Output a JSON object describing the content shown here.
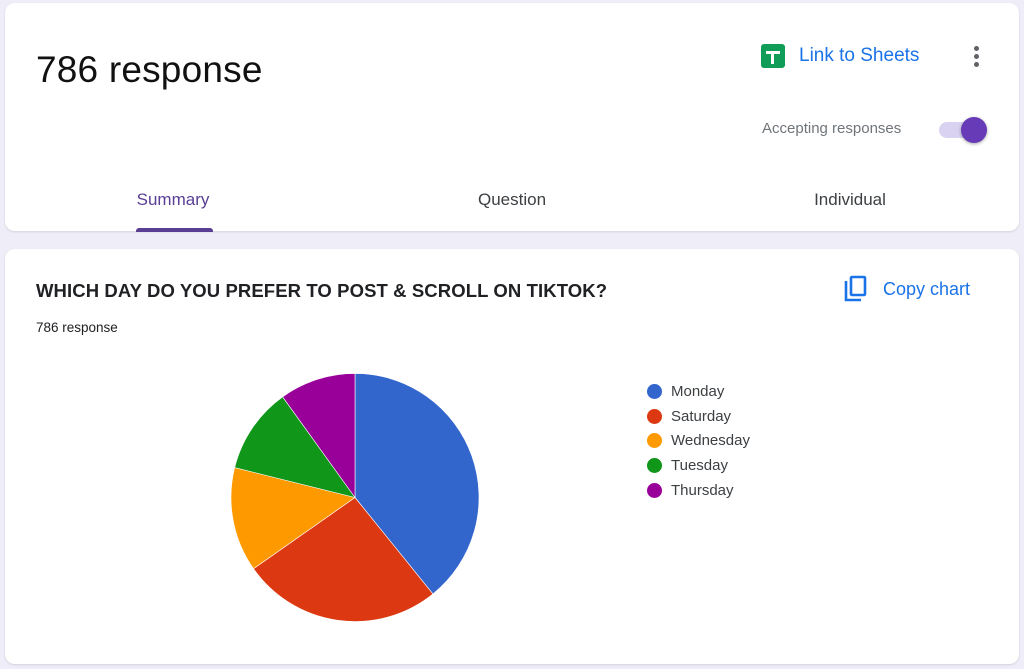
{
  "header": {
    "title": "786 response",
    "link_sheets_label": "Link to Sheets",
    "more_icon": "more-vert-icon",
    "accepting_label": "Accepting responses",
    "accepting_on": true
  },
  "tabs": [
    {
      "label": "Summary",
      "active": true
    },
    {
      "label": "Question",
      "active": false
    },
    {
      "label": "Individual",
      "active": false
    }
  ],
  "question": {
    "title": "WHICH DAY DO YOU PREFER TO POST & SCROLL ON TIKTOK?",
    "count": "786 response",
    "copy_chart_label": "Copy chart"
  },
  "chart_data": {
    "type": "pie",
    "title": "WHICH DAY DO YOU PREFER TO POST & SCROLL ON TIKTOK?",
    "total": 786,
    "categories": [
      "Monday",
      "Saturday",
      "Wednesday",
      "Tuesday",
      "Thursday"
    ],
    "values": [
      308,
      205,
      107,
      88,
      78
    ],
    "percentages": [
      39.1,
      26.1,
      13.6,
      11.2,
      9.9
    ],
    "colors": [
      "#3366cc",
      "#dc3912",
      "#ff9900",
      "#109618",
      "#990099"
    ],
    "legend": "right",
    "start_angle": "12 o'clock, clockwise"
  }
}
